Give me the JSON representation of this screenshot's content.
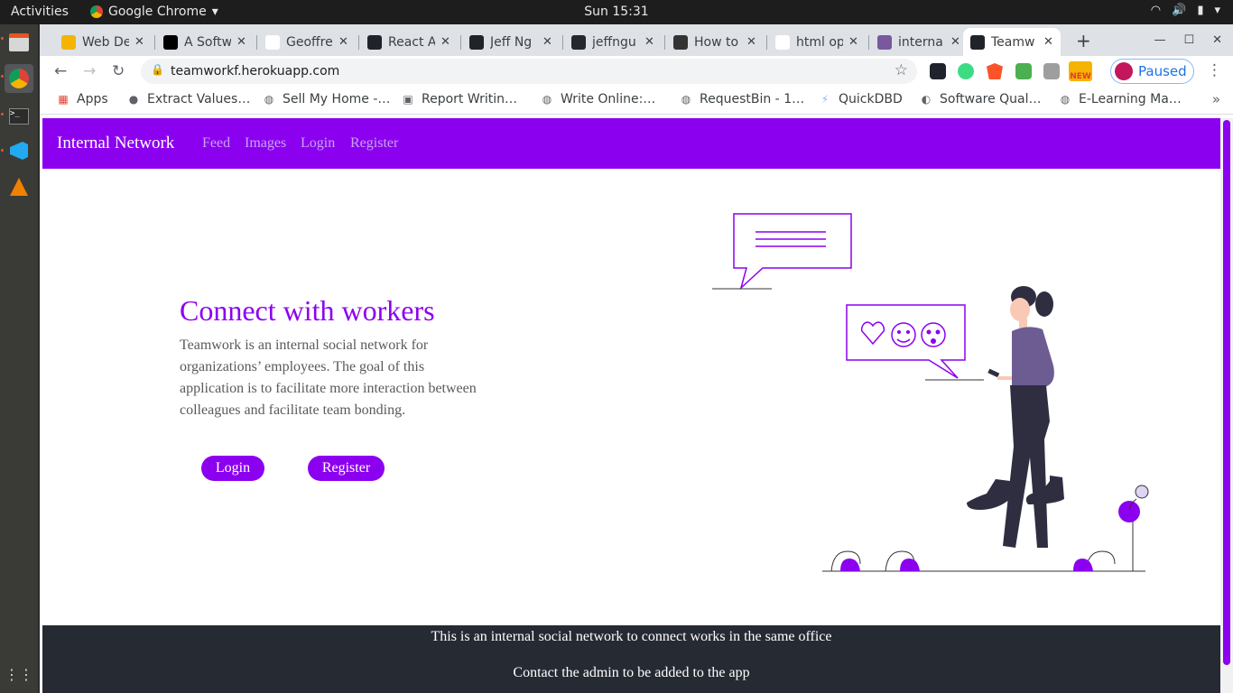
{
  "topbar": {
    "activities": "Activities",
    "app_name": "Google Chrome",
    "clock": "Sun 15:31"
  },
  "tabs": [
    {
      "title": "Web De",
      "favicon": "wrench-icon",
      "color": "#f4b400"
    },
    {
      "title": "A Softw",
      "favicon": "medium-icon",
      "color": "#000000"
    },
    {
      "title": "Geoffre",
      "favicon": "m-icon",
      "color": "#ffffff"
    },
    {
      "title": "React A",
      "favicon": "react-icon",
      "color": "#20232a"
    },
    {
      "title": "Jeff Ng",
      "favicon": "react-icon",
      "color": "#20232a"
    },
    {
      "title": "jeffngu",
      "favicon": "github-icon",
      "color": "#24292e"
    },
    {
      "title": "How to",
      "favicon": "linux-icon",
      "color": "#333333"
    },
    {
      "title": "html op",
      "favicon": "google-icon",
      "color": "#ffffff"
    },
    {
      "title": "interna",
      "favicon": "heroku-icon",
      "color": "#79589f"
    },
    {
      "title": "Teamw",
      "favicon": "react-icon",
      "color": "#20232a",
      "active": true
    }
  ],
  "toolbar": {
    "url": "teamworkf.herokuapp.com",
    "profile_label": "Paused",
    "ext_badge": "NEW"
  },
  "bookmarks": [
    "Apps",
    "Extract Values…",
    "Sell My Home -…",
    "Report Writin…",
    "Write Online:…",
    "RequestBin - 1…",
    "QuickDBD",
    "Software Qual…",
    "E-Learning Ma…"
  ],
  "site": {
    "brand": "Internal Network",
    "nav": [
      "Feed",
      "Images",
      "Login",
      "Register"
    ],
    "hero_title": "Connect with workers",
    "hero_text": "Teamwork is an internal social network for organizations’ employees. The goal of this application is to facilitate more interaction between colleagues and facilitate team bonding.",
    "login_button": "Login",
    "register_button": "Register",
    "footer_line1": "This is an internal social network to connect works in the same office",
    "footer_line2": "Contact the admin to be added to the app"
  },
  "colors": {
    "accent": "#8c00f0",
    "footer_bg": "#262a33",
    "nav_link": "#c9a1f5"
  }
}
